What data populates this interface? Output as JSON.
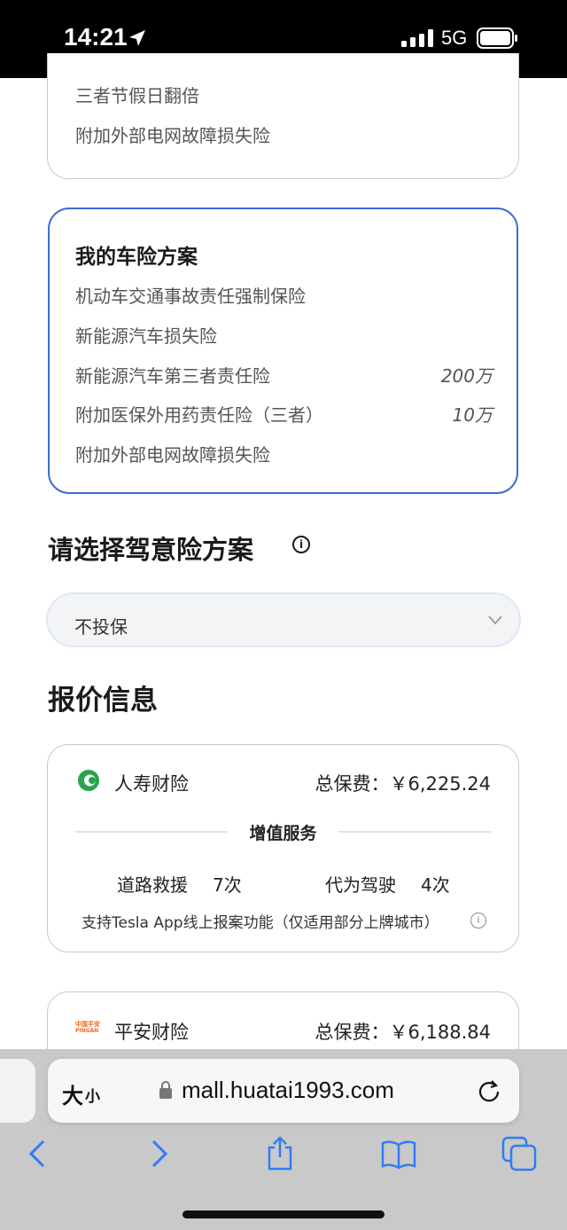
{
  "status": {
    "time": "14:21",
    "network": "5G"
  },
  "top_card": {
    "rows": [
      "三者节假日翻倍",
      "附加外部电网故障损失险"
    ]
  },
  "plan": {
    "title": "我的车险方案",
    "rows": [
      {
        "name": "机动车交通事故责任强制保险",
        "value": ""
      },
      {
        "name": "新能源汽车损失险",
        "value": ""
      },
      {
        "name": "新能源汽车第三者责任险",
        "value": "200万"
      },
      {
        "name": "附加医保外用药责任险（三者）",
        "value": "10万"
      },
      {
        "name": "附加外部电网故障损失险",
        "value": ""
      }
    ]
  },
  "driver_section": {
    "title": "请选择驾意险方案",
    "info_icon": "i",
    "select_value": "不投保"
  },
  "quote_section": {
    "title": "报价信息"
  },
  "quotes": [
    {
      "insurer": "人寿财险",
      "premium": "总保费：￥6,225.24",
      "vas_title": "增值服务",
      "services": [
        {
          "label": "道路救援",
          "count": "7次"
        },
        {
          "label": "代为驾驶",
          "count": "4次"
        }
      ],
      "support_text": "支持Tesla App线上报案功能（仅适用部分上牌城市）",
      "info_icon": "i"
    },
    {
      "insurer": "平安财险",
      "premium": "总保费：￥6,188.84",
      "logo_text_cn": "中国平安",
      "logo_text_en": "PINGAN"
    }
  ],
  "safari": {
    "aa_big": "大",
    "aa_small": "小",
    "url": "mall.huatai1993.com"
  },
  "colors": {
    "accent": "#3d6cd6",
    "safari_blue": "#2f7cf6",
    "logo_green": "#2aa34a",
    "pingan_orange": "#f26522"
  }
}
